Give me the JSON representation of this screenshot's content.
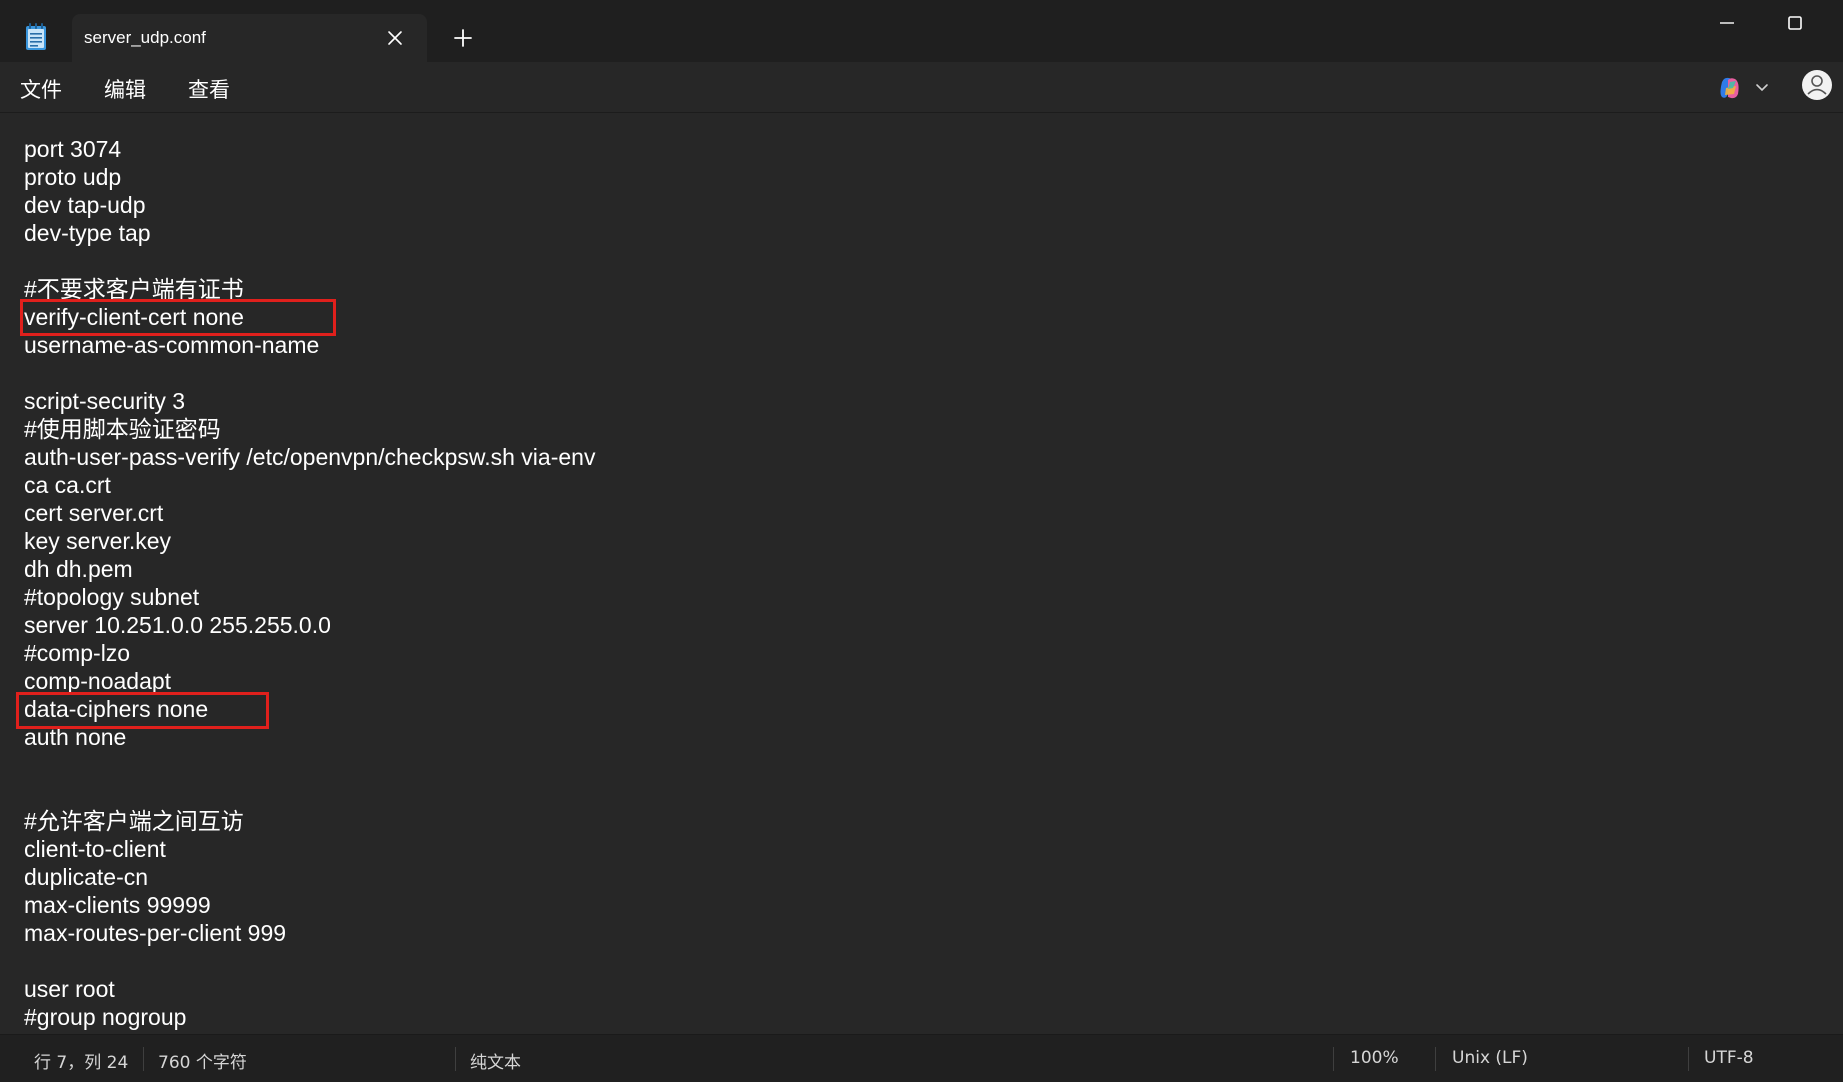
{
  "tab": {
    "title": "server_udp.conf"
  },
  "menu": {
    "file": "文件",
    "edit": "编辑",
    "view": "查看"
  },
  "icons": {
    "app": "notepad-icon",
    "close_tab": "close-icon",
    "new_tab": "plus-icon",
    "minimize": "minimize-icon",
    "maximize": "maximize-icon",
    "copilot": "copilot-icon",
    "chevron": "chevron-down-icon",
    "account": "avatar-icon"
  },
  "colors": {
    "background": "#272727",
    "titlebar": "#1f1f1f",
    "statusbar": "#202020",
    "text": "#ffffff",
    "highlight_box": "#e0201c"
  },
  "editor": {
    "lines": [
      "port 3074",
      "proto udp",
      "dev tap-udp",
      "dev-type tap",
      "",
      "#不要求客户端有证书",
      "verify-client-cert none",
      "username-as-common-name",
      "",
      "script-security 3",
      "#使用脚本验证密码",
      "auth-user-pass-verify /etc/openvpn/checkpsw.sh via-env",
      "ca ca.crt",
      "cert server.crt",
      "key server.key",
      "dh dh.pem",
      "#topology subnet",
      "server 10.251.0.0 255.255.0.0",
      "#comp-lzo",
      "comp-noadapt",
      "data-ciphers none",
      "auth none",
      "",
      "",
      "#允许客户端之间互访",
      "client-to-client",
      "duplicate-cn",
      "max-clients 99999",
      "max-routes-per-client 999",
      "",
      "user root",
      "#group nogroup"
    ]
  },
  "status": {
    "position": "行 7，列 24",
    "char_count": "760 个字符",
    "format": "纯文本",
    "zoom": "100%",
    "line_ending": "Unix (LF)",
    "encoding": "UTF-8"
  }
}
